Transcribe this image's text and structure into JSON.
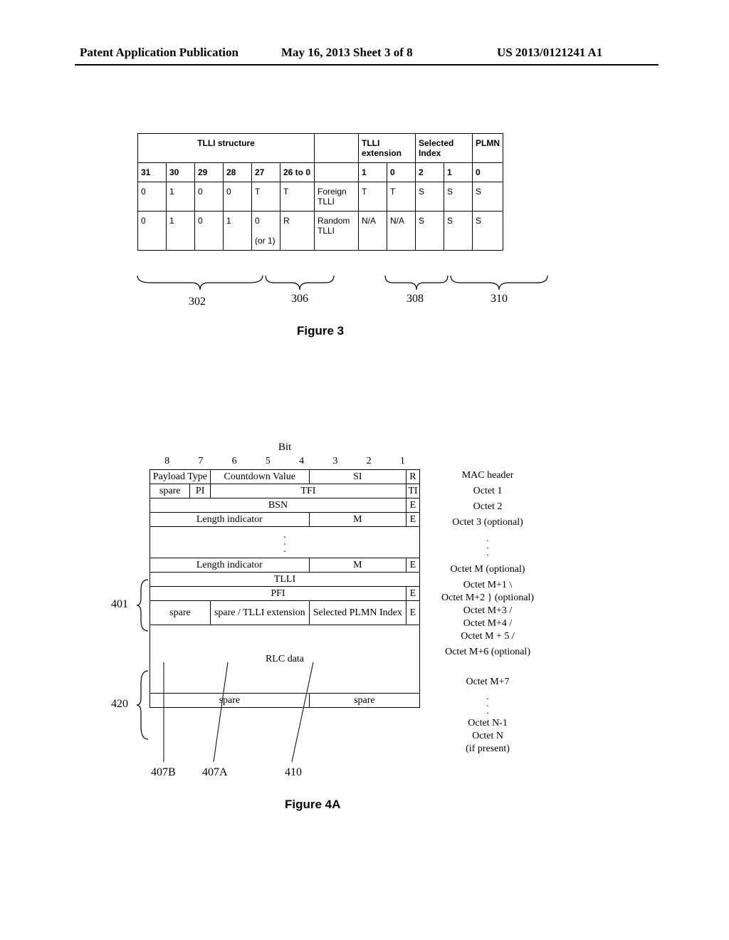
{
  "header": {
    "left": "Patent Application Publication",
    "mid": "May 16, 2013  Sheet 3 of 8",
    "right": "US 2013/0121241 A1"
  },
  "fig3": {
    "groupHeads": {
      "g1": "TLLI structure",
      "g2": "",
      "g3": "TLLI extension",
      "g4": "Selected Index",
      "g5": "PLMN"
    },
    "bitHead": {
      "b31": "31",
      "b30": "30",
      "b29": "29",
      "b28": "28",
      "b27": "27",
      "b26": "26 to 0",
      "b_": "",
      "e1": "1",
      "e0": "0",
      "s2": "2",
      "s1": "1",
      "s0": "0"
    },
    "row1": {
      "c0": "0",
      "c1": "1",
      "c2": "0",
      "c3": "0",
      "c4": "T",
      "c5": "T",
      "lbl": "Foreign TLLI",
      "e1": "T",
      "e0": "T",
      "s2": "S",
      "s1": "S",
      "s0": "S"
    },
    "row2": {
      "c0": "0",
      "c1": "1",
      "c2": "0",
      "c3": "1",
      "c4": "0",
      "c4b": "(or 1)",
      "c5": "R",
      "lbl": "Random TLLI",
      "e1": "N/A",
      "e0": "N/A",
      "s2": "S",
      "s1": "S",
      "s0": "S"
    },
    "refs": {
      "r302": "302",
      "r306": "306",
      "r308": "308",
      "r310": "310"
    },
    "caption": "Figure 3"
  },
  "fig4": {
    "bitLabel": "Bit",
    "bits": {
      "b8": "8",
      "b7": "7",
      "b6": "6",
      "b5": "5",
      "b4": "4",
      "b3": "3",
      "b2": "2",
      "b1": "1"
    },
    "r0": {
      "a": "Payload Type",
      "b": "Countdown Value",
      "c": "SI",
      "d": "R",
      "side": "MAC header"
    },
    "r1": {
      "a": "spare",
      "b": "PI",
      "c": "TFI",
      "d": "TI",
      "side": "Octet 1"
    },
    "r2": {
      "a": "BSN",
      "b": "E",
      "side": "Octet 2"
    },
    "r3": {
      "a": "Length indicator",
      "b": "M",
      "c": "E",
      "side": "Octet 3 (optional)"
    },
    "r4": {
      "a": "Length indicator",
      "b": "M",
      "c": "E",
      "side": "Octet M (optional)"
    },
    "tlli": {
      "a": "TLLI",
      "side1": "Octet M+1 \\",
      "side2": "Octet M+2  } (optional)",
      "side3": "Octet M+3 /",
      "side4": "Octet M+4 /"
    },
    "r5": {
      "a": "PFI",
      "b": "E",
      "side": "Octet M + 5 /"
    },
    "r6": {
      "a": "spare",
      "b": "spare / TLLI extension",
      "c": "Selected PLMN Index",
      "d": "E",
      "side": "Octet M+6 (optional)"
    },
    "rlc": {
      "a": "RLC data",
      "sideA": "Octet M+7",
      "sideB": "Octet N-1",
      "sideC": "Octet N"
    },
    "rsp": {
      "a": "spare",
      "b": "spare",
      "side": "(if present)"
    },
    "refs": {
      "r401": "401",
      "r420": "420",
      "r407B": "407B",
      "r407A": "407A",
      "r410": "410"
    },
    "caption": "Figure 4A"
  }
}
